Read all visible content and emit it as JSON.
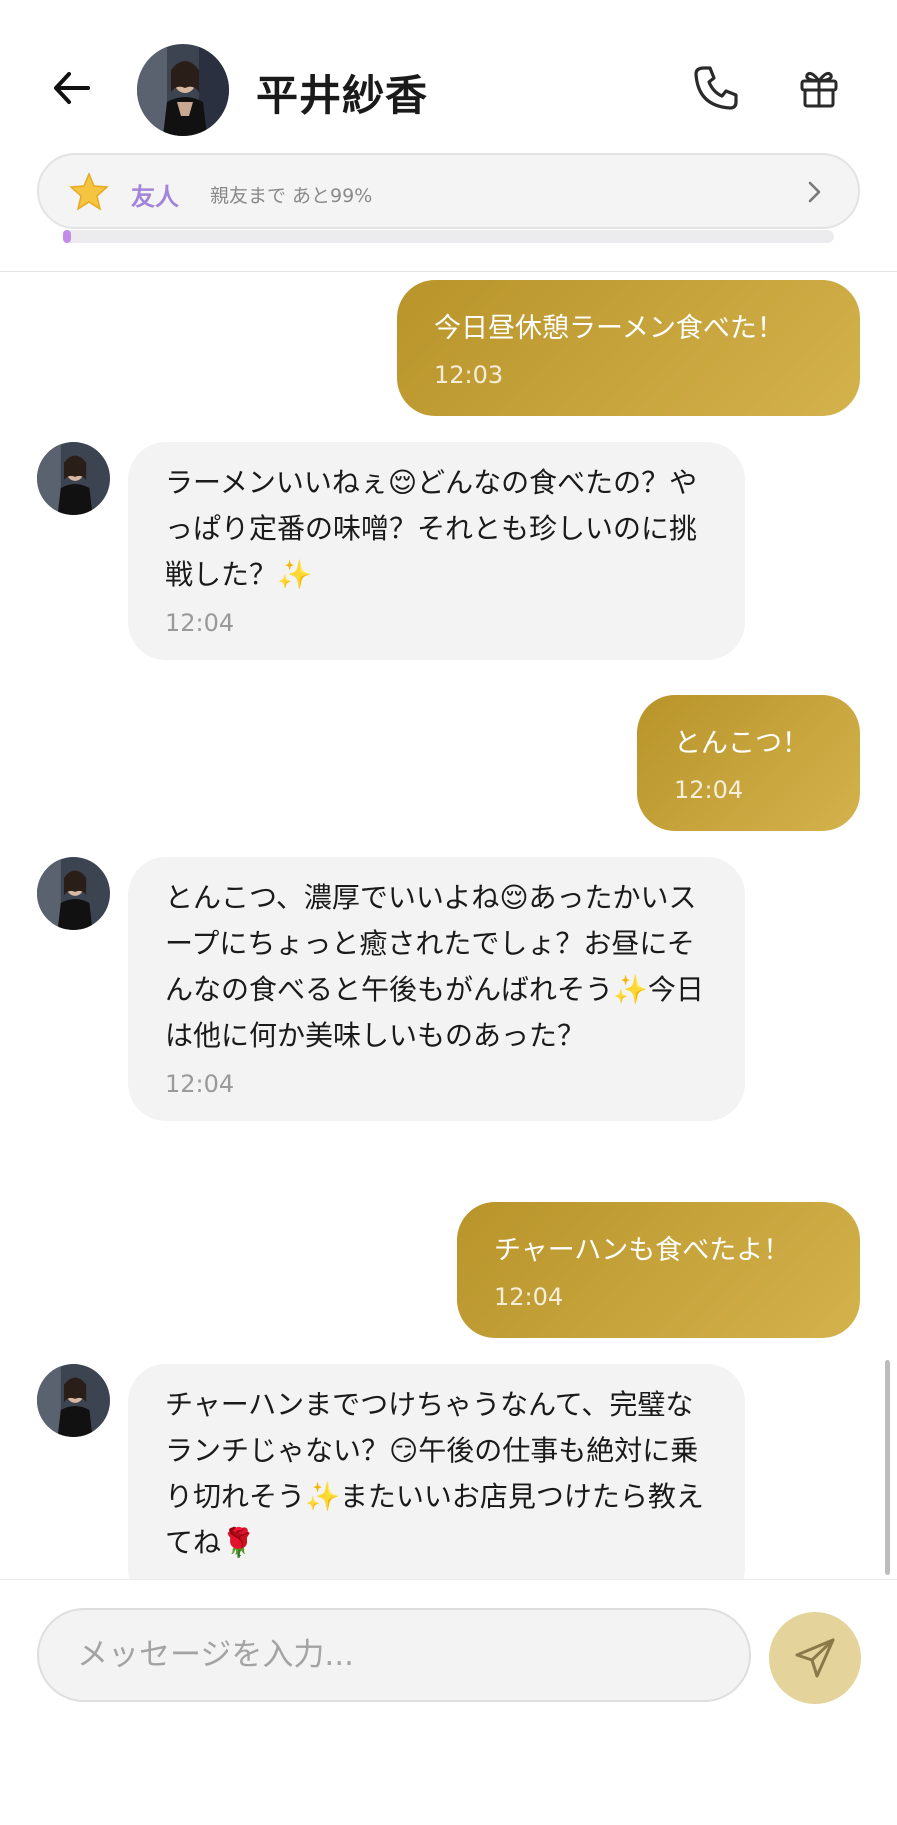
{
  "header": {
    "contact_name": "平井紗香",
    "relation_label": "友人",
    "relation_progress_text": "親友まで あと99%",
    "relation_progress_value": 0.01,
    "icons": {
      "back": "arrow-left-icon",
      "call": "phone-icon",
      "gift": "gift-icon",
      "relation": "star-icon",
      "chevron": "chevron-right-icon"
    }
  },
  "messages": [
    {
      "dir": "out",
      "text": "今日昼休憩ラーメン食べた！",
      "time": "12:03"
    },
    {
      "dir": "in",
      "text": "ラーメンいいねぇ😌どんなの食べたの？やっぱり定番の味噌？それとも珍しいのに挑戦した？✨",
      "time": "12:04"
    },
    {
      "dir": "out",
      "text": "とんこつ！",
      "time": "12:04"
    },
    {
      "dir": "in",
      "text": "とんこつ、濃厚でいいよね😌あったかいスープにちょっと癒されたでしょ？お昼にそんなの食べると午後もがんばれそう✨今日は他に何か美味しいものあった？",
      "time": "12:04"
    },
    {
      "dir": "out",
      "text": "チャーハンも食べたよ！",
      "time": "12:04"
    },
    {
      "dir": "in",
      "text": "チャーハンまでつけちゃうなんて、完璧なランチじゃない？😏午後の仕事も絶対に乗り切れそう✨またいいお店見つけたら教えてね🌹",
      "time": ""
    }
  ],
  "composer": {
    "placeholder": "メッセージを入力...",
    "send_icon": "paper-plane-icon"
  },
  "colors": {
    "outgoing_bubble": "#c4a23c",
    "incoming_bubble": "#f3f3f4",
    "relation_accent": "#a384d8",
    "progress_fill": "#c48ce8",
    "send_button": "#e4d39a"
  }
}
